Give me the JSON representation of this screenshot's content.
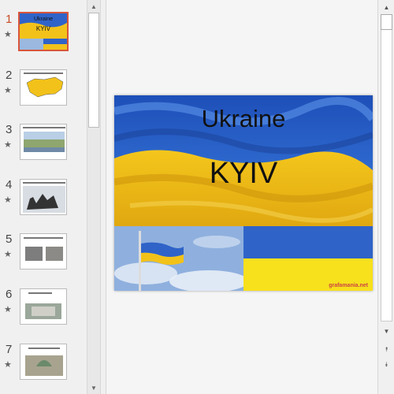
{
  "thumbnails": [
    {
      "number": "1",
      "star": "★",
      "title": "Ukraine",
      "subtitle": "KYIV",
      "active": true
    },
    {
      "number": "2",
      "star": "★"
    },
    {
      "number": "3",
      "star": "★"
    },
    {
      "number": "4",
      "star": "★"
    },
    {
      "number": "5",
      "star": "★"
    },
    {
      "number": "6",
      "star": "★"
    },
    {
      "number": "7",
      "star": "★"
    }
  ],
  "scroll": {
    "up": "▲",
    "down": "▼",
    "prev_slide": "⯭",
    "next_slide": "⯯"
  },
  "slide": {
    "title": "Ukraine",
    "subtitle": "KYIV",
    "watermark": "grafamania.net"
  },
  "colors": {
    "accent": "#d9553a",
    "flag_blue": "#2f63c8",
    "flag_yellow": "#f2c21a"
  }
}
